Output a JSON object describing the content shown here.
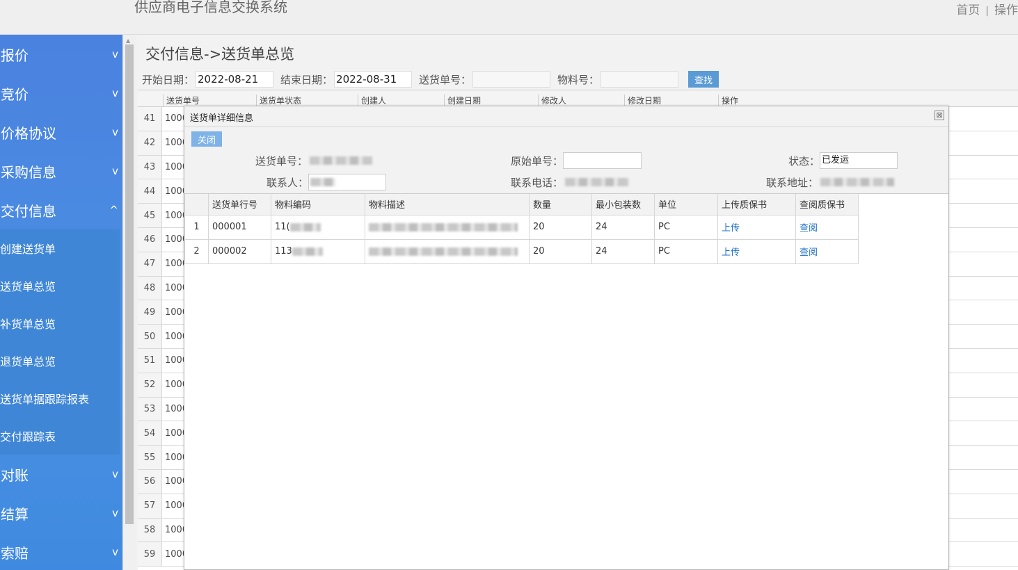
{
  "header": {
    "system_title": "供应商电子信息交换系统",
    "link_home": "首页",
    "link_separator": "|",
    "link_ops": "操作"
  },
  "sidebar": {
    "items": [
      {
        "label": "报价",
        "chevron": "v"
      },
      {
        "label": "竞价",
        "chevron": "v"
      },
      {
        "label": "价格协议",
        "chevron": "v"
      },
      {
        "label": "采购信息",
        "chevron": "v"
      },
      {
        "label": "交付信息",
        "chevron": "^"
      }
    ],
    "sub_items": [
      "创建送货单",
      "送货单总览",
      "补货单总览",
      "退货单总览",
      "送货单据跟踪报表",
      "交付跟踪表"
    ],
    "items_after": [
      {
        "label": "对账",
        "chevron": "v"
      },
      {
        "label": "结算",
        "chevron": "v"
      },
      {
        "label": "索赔",
        "chevron": "v"
      }
    ]
  },
  "main": {
    "title": "交付信息->送货单总览",
    "filters": {
      "start_label": "开始日期：",
      "start_value": "2022-08-21",
      "end_label": "结束日期：",
      "end_value": "2022-08-31",
      "delivery_no_label": "送货单号：",
      "delivery_no_value": "",
      "material_no_label": "物料号：",
      "material_no_value": "",
      "search_label": "查找"
    },
    "grid": {
      "columns": [
        "送货单号",
        "送货单状态",
        "创建人",
        "创建日期",
        "修改人",
        "修改日期",
        "操作"
      ],
      "rows": [
        {
          "n": "41",
          "c1": "1000"
        },
        {
          "n": "42",
          "c1": "1000"
        },
        {
          "n": "43",
          "c1": "1000"
        },
        {
          "n": "44",
          "c1": "1000"
        },
        {
          "n": "45",
          "c1": "1000"
        },
        {
          "n": "46",
          "c1": "1000"
        },
        {
          "n": "47",
          "c1": "1000"
        },
        {
          "n": "48",
          "c1": "1000"
        },
        {
          "n": "49",
          "c1": "1000"
        },
        {
          "n": "50",
          "c1": "1000"
        },
        {
          "n": "51",
          "c1": "1000"
        },
        {
          "n": "52",
          "c1": "1000"
        },
        {
          "n": "53",
          "c1": "1000"
        },
        {
          "n": "54",
          "c1": "1000"
        },
        {
          "n": "55",
          "c1": "1000"
        },
        {
          "n": "56",
          "c1": "1000"
        },
        {
          "n": "57",
          "c1": "1000"
        },
        {
          "n": "58",
          "c1": "1000"
        },
        {
          "n": "59",
          "c1": "1000"
        }
      ]
    }
  },
  "modal": {
    "title": "送货单详细信息",
    "close_icon": "⊠",
    "close_button": "关闭",
    "form": {
      "delivery_no_label": "送货单号：",
      "orig_no_label": "原始单号：",
      "orig_no_value": "",
      "status_label": "状态：",
      "status_value": "已发运",
      "contact_label": "联系人：",
      "phone_label": "联系电话：",
      "address_label": "联系地址："
    },
    "table": {
      "columns": [
        "送货单行号",
        "物料编码",
        "物料描述",
        "数量",
        "最小包装数",
        "单位",
        "上传质保书",
        "查阅质保书"
      ],
      "rows": [
        {
          "rn": "1",
          "line_no": "000001",
          "material_code": "11(",
          "qty": "20",
          "min_pack": "24",
          "unit": "PC",
          "upload": "上传",
          "view": "查阅"
        },
        {
          "rn": "2",
          "line_no": "000002",
          "material_code": "113",
          "qty": "20",
          "min_pack": "24",
          "unit": "PC",
          "upload": "上传",
          "view": "查阅"
        }
      ]
    }
  }
}
